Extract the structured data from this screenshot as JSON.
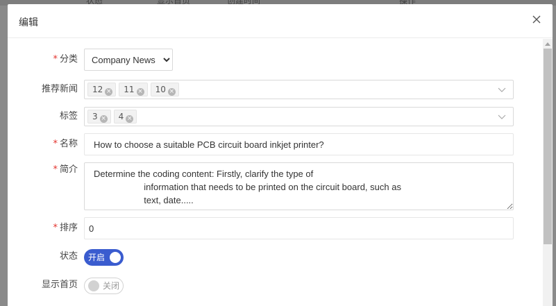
{
  "backdrop": {
    "columns": [
      "状态",
      "显示首页",
      "创建时间",
      "操作"
    ]
  },
  "dialog": {
    "title": "编辑"
  },
  "form": {
    "category": {
      "label": "分类",
      "value": "Company News",
      "options": [
        "Company News"
      ]
    },
    "recommended_news": {
      "label": "推荐新闻",
      "tags": [
        "12",
        "11",
        "10"
      ]
    },
    "tags": {
      "label": "标签",
      "tags": [
        "3",
        "4"
      ]
    },
    "name": {
      "label": "名称",
      "value": "How to choose a suitable PCB circuit board inkjet printer?"
    },
    "intro": {
      "label": "简介",
      "value": "Determine the coding content: Firstly, clarify the type of\n                    information that needs to be printed on the circuit board, such as\n                    text, date....."
    },
    "sort": {
      "label": "排序",
      "value": "0"
    },
    "status": {
      "label": "状态",
      "on_text": "开启",
      "enabled": true
    },
    "show_home": {
      "label": "显示首页",
      "off_text": "关闭",
      "enabled": false
    }
  },
  "colors": {
    "accent": "#3a5ccf",
    "required": "#e2322d"
  }
}
